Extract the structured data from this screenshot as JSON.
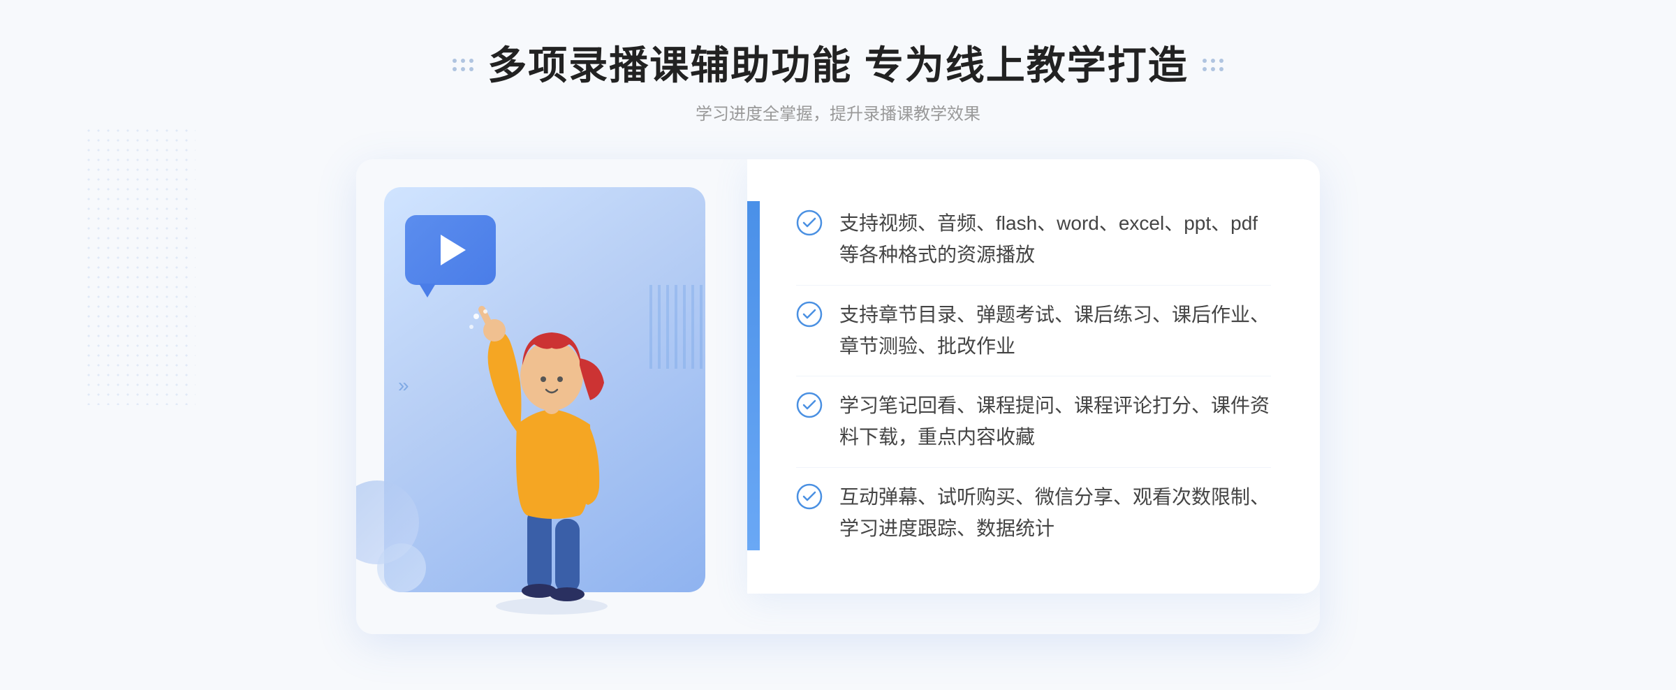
{
  "header": {
    "title": "多项录播课辅助功能 专为线上教学打造",
    "subtitle": "学习进度全掌握，提升录播课教学效果"
  },
  "features": {
    "items": [
      {
        "id": "feature-1",
        "text": "支持视频、音频、flash、word、excel、ppt、pdf等各种格式的资源播放"
      },
      {
        "id": "feature-2",
        "text": "支持章节目录、弹题考试、课后练习、课后作业、章节测验、批改作业"
      },
      {
        "id": "feature-3",
        "text": "学习笔记回看、课程提问、课程评论打分、课件资料下载，重点内容收藏"
      },
      {
        "id": "feature-4",
        "text": "互动弹幕、试听购买、微信分享、观看次数限制、学习进度跟踪、数据统计"
      }
    ]
  },
  "colors": {
    "primary": "#4a7de8",
    "check": "#4a90e2",
    "title": "#222222",
    "subtitle": "#999999",
    "text": "#444444"
  }
}
